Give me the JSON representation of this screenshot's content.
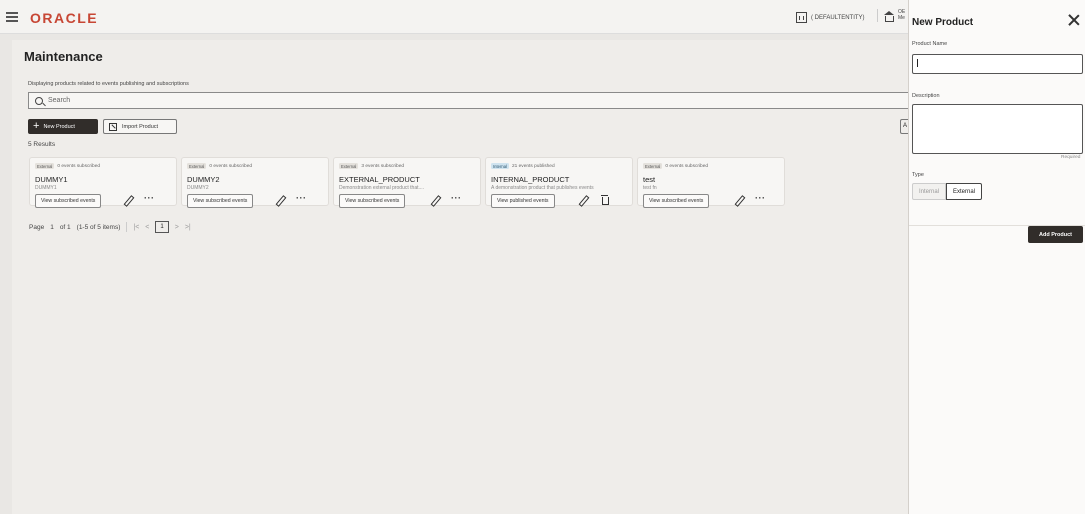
{
  "header": {
    "logo": "ORACLE",
    "entity": "( DEFAULTENTITY)",
    "branch_line1": "OE",
    "branch_line2": "Me"
  },
  "main": {
    "title": "Maintenance",
    "subtitle": "Displaying products related to events publishing and subscriptions",
    "search_placeholder": "Search",
    "new_product_label": "New Product",
    "import_product_label": "Import Product",
    "results": "5 Results",
    "edge_button": "A"
  },
  "cards": [
    {
      "badge": "External",
      "badge_type": "external",
      "status": "0 events subscribed",
      "name": "DUMMY1",
      "desc": "DUMMY1",
      "view_label": "View subscribed events",
      "actions": [
        "edit-icon",
        "more-icon"
      ]
    },
    {
      "badge": "External",
      "badge_type": "external",
      "status": "0 events subscribed",
      "name": "DUMMY2",
      "desc": "DUMMY2",
      "view_label": "View subscribed events",
      "actions": [
        "edit-icon",
        "more-icon"
      ]
    },
    {
      "badge": "External",
      "badge_type": "external",
      "status": "3 events subscribed",
      "name": "EXTERNAL_PRODUCT",
      "desc": "Demonstration external product that....",
      "view_label": "View subscribed events",
      "actions": [
        "edit-icon",
        "more-icon"
      ]
    },
    {
      "badge": "Internal",
      "badge_type": "internal",
      "status": "21 events published",
      "name": "INTERNAL_PRODUCT",
      "desc": "A demonstration product that publishes events",
      "view_label": "View published events",
      "actions": [
        "edit-icon",
        "delete-icon"
      ]
    },
    {
      "badge": "External",
      "badge_type": "external",
      "status": "0 events subscribed",
      "name": "test",
      "desc": "test fn",
      "view_label": "View subscribed events",
      "actions": [
        "edit-icon",
        "more-icon"
      ]
    }
  ],
  "pager": {
    "page_label": "Page",
    "page_value": "1",
    "of_label": "of 1",
    "items_label": "(1-5 of 5 items)",
    "first": "|<",
    "prev": "<",
    "current": "1",
    "next": ">",
    "last": ">|"
  },
  "drawer": {
    "title": "New Product",
    "product_name_label": "Product Name",
    "product_name_value": "",
    "description_label": "Description",
    "description_value": "",
    "required_text": "Required",
    "type_label": "Type",
    "type_options": [
      "Internal",
      "External"
    ],
    "type_selected": "External",
    "add_button": "Add Product"
  },
  "colors": {
    "brand": "#c74634",
    "primary_button": "#312d2a",
    "internal_badge": "#cfe3ef"
  }
}
